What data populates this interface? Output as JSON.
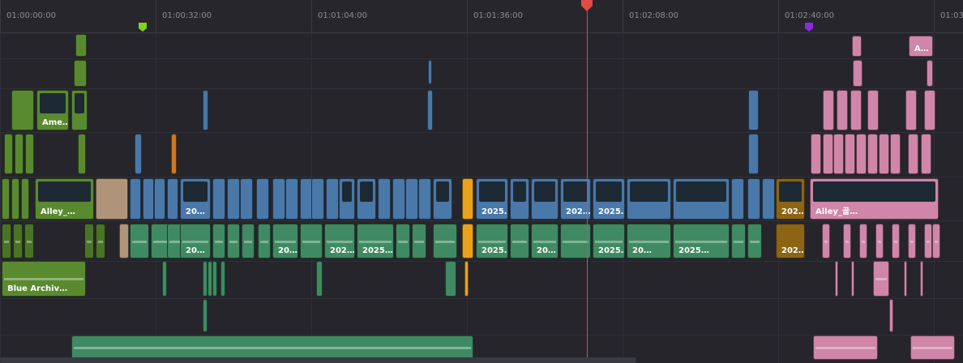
{
  "ruler": {
    "timecodes": [
      "01:00:00:00",
      "01:00:32:00",
      "01:01:04:00",
      "01:01:36:00",
      "01:02:08:00",
      "01:02:40:00",
      "01:03"
    ]
  },
  "markers": [
    {
      "name": "marker-green",
      "color": "#7ed321"
    },
    {
      "name": "marker-purple",
      "color": "#8a2be2"
    }
  ],
  "playhead": {
    "color": "#e24a45"
  },
  "colors": {
    "green": "#5a8a2f",
    "green_dark": "#4a7326",
    "blue": "#4a78a8",
    "teal": "#3f8a62",
    "pink": "#cf86a8",
    "tan": "#b0947a",
    "orange": "#d2761e",
    "gold": "#8c6414",
    "yellow": "#e8a21c"
  },
  "clips": [
    {
      "label": "Ame…",
      "color": "#5a8a2f",
      "thumb": true
    },
    {
      "label": "Alley_…",
      "color": "#5a8a2f",
      "thumb": true
    },
    {
      "label": "20…",
      "color": "#4a78a8",
      "thumb": true
    },
    {
      "label": "2025…",
      "color": "#4a78a8",
      "thumb": true
    },
    {
      "label": "202…",
      "color": "#4a78a8",
      "thumb": true
    },
    {
      "label": "2025…",
      "color": "#4a78a8",
      "thumb": true
    },
    {
      "label": "202…",
      "color": "#8c6414",
      "thumb": true
    },
    {
      "label": "Alley_골…",
      "color": "#cf86a8",
      "thumb": true
    },
    {
      "label": "A…",
      "color": "#cf86a8",
      "thumb": false
    },
    {
      "label": "2025…",
      "color": "#3f8a62",
      "thumb": false
    },
    {
      "label": "20…",
      "color": "#3f8a62",
      "thumb": false
    },
    {
      "label": "20…",
      "color": "#3f8a62",
      "thumb": false
    },
    {
      "label": "202…",
      "color": "#3f8a62",
      "thumb": false
    },
    {
      "label": "2025…",
      "color": "#3f8a62",
      "thumb": false
    },
    {
      "label": "2025…",
      "color": "#3f8a62",
      "thumb": false
    },
    {
      "label": "2025…",
      "color": "#3f8a62",
      "thumb": false
    },
    {
      "label": "20…",
      "color": "#3f8a62",
      "thumb": false
    },
    {
      "label": "20…",
      "color": "#3f8a62",
      "thumb": false
    },
    {
      "label": "20…",
      "color": "#4a78a8",
      "thumb": false
    },
    {
      "label": "2025…",
      "color": "#4a78a8",
      "thumb": false
    },
    {
      "label": "202…",
      "color": "#8c6414",
      "thumb": false
    },
    {
      "label": "Blue Archiv…",
      "color": "#5a8a2f",
      "thumb": false
    }
  ]
}
